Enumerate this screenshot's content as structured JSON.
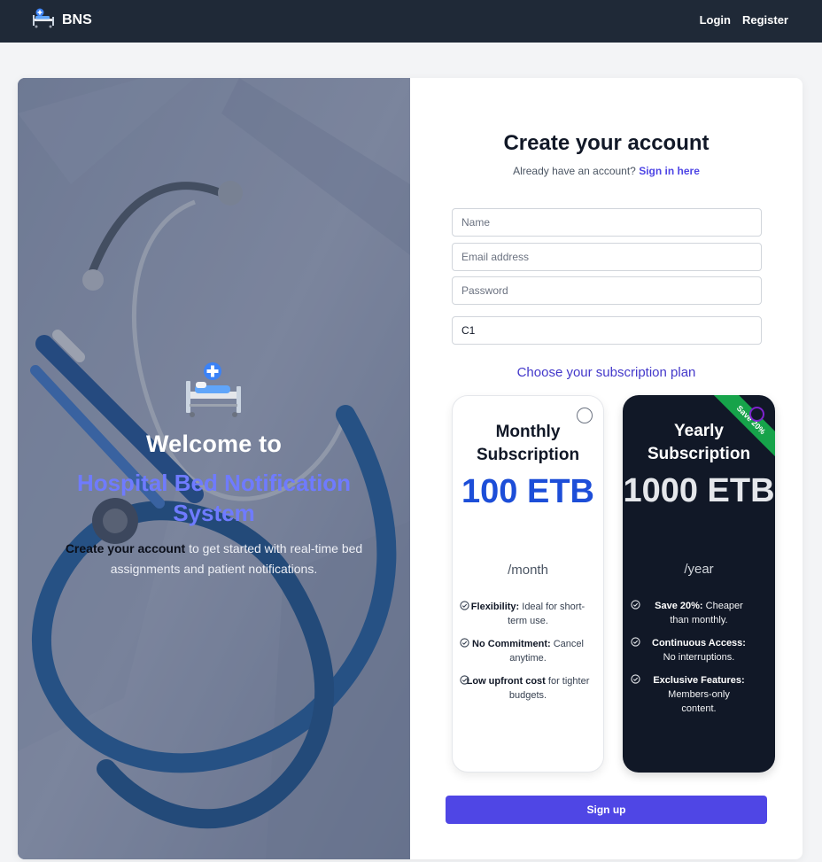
{
  "navbar": {
    "brand": "BNS",
    "links": {
      "login": "Login",
      "register": "Register"
    }
  },
  "hero": {
    "welcome": "Welcome to",
    "system_name": "Hospital Bed Notification System",
    "desc_bold": "Create your account",
    "desc_rest": " to get started with real-time bed assignments and patient notifications."
  },
  "form": {
    "title": "Create your account",
    "subtitle_prefix": "Already have an account? ",
    "signin_link": "Sign in here",
    "name_placeholder": "Name",
    "email_placeholder": "Email address",
    "password_placeholder": "Password",
    "code_value": "C1",
    "plan_heading": "Choose your subscription plan",
    "signup_label": "Sign up"
  },
  "plans": {
    "monthly": {
      "name": "Monthly Subscription",
      "price": "100 ETB",
      "period": "/month",
      "features": [
        {
          "title": "Flexibility:",
          "text": " Ideal for short-term use."
        },
        {
          "title": "No Commitment:",
          "text": " Cancel anytime."
        },
        {
          "title": "Low upfront cost",
          "text": " for tighter budgets."
        }
      ]
    },
    "yearly": {
      "name": "Yearly Subscription",
      "price": "1000 ETB",
      "period": "/year",
      "ribbon": "Save 20%",
      "features": [
        {
          "title": "Save 20%:",
          "text": " Cheaper than monthly."
        },
        {
          "title": "Continuous Access:",
          "text": " No interruptions."
        },
        {
          "title": "Exclusive Features:",
          "text": " Members-only content."
        }
      ]
    }
  },
  "colors": {
    "navbar": "#1f2937",
    "accent": "#4f46e5",
    "price_monthly": "#1d4ed8",
    "ribbon": "#16a34a",
    "yearly_card": "#111827"
  }
}
